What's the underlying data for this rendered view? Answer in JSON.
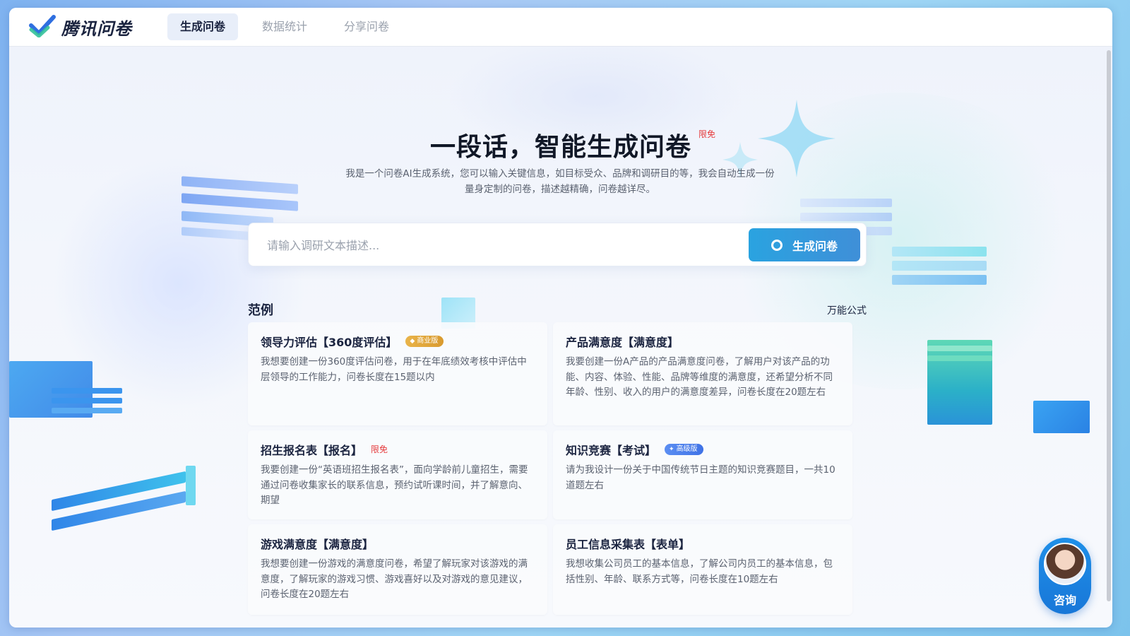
{
  "header": {
    "logo_text": "腾讯问卷",
    "tabs": [
      {
        "label": "生成问卷",
        "active": true
      },
      {
        "label": "数据统计",
        "active": false
      },
      {
        "label": "分享问卷",
        "active": false
      }
    ]
  },
  "hero": {
    "title": "一段话，智能生成问卷",
    "badge": "限免",
    "desc_line1": "我是一个问卷AI生成系统，您可以输入关键信息，如目标受众、品牌和调研目的等，我会自动生成一份",
    "desc_line2": "量身定制的问卷，描述越精确，问卷越详尽。"
  },
  "search": {
    "placeholder": "请输入调研文本描述...",
    "value": "",
    "button_label": "生成问卷"
  },
  "examples": {
    "label": "范例",
    "formula_link": "万能公式",
    "cards": [
      {
        "title": "领导力评估【360度评估】",
        "tag": "商业版",
        "tag_style": "gold",
        "desc": "我想要创建一份360度评估问卷，用于在年底绩效考核中评估中层领导的工作能力，问卷长度在15题以内"
      },
      {
        "title": "产品满意度【满意度】",
        "tag": "",
        "tag_style": "",
        "desc": "我要创建一份A产品的产品满意度问卷，了解用户对该产品的功能、内容、体验、性能、品牌等维度的满意度，还希望分析不同年龄、性别、收入的用户的满意度差异，问卷长度在20题左右"
      },
      {
        "title": "招生报名表【报名】",
        "tag": "限免",
        "tag_style": "free",
        "desc": "我要创建一份“英语班招生报名表”，面向学龄前儿童招生，需要通过问卷收集家长的联系信息，预约试听课时间，并了解意向、期望"
      },
      {
        "title": "知识竞赛【考试】",
        "tag": "高级版",
        "tag_style": "blue",
        "desc": "请为我设计一份关于中国传统节日主题的知识竞赛题目，一共10道题左右"
      },
      {
        "title": "游戏满意度【满意度】",
        "tag": "",
        "tag_style": "",
        "desc": "我想要创建一份游戏的满意度问卷，希望了解玩家对该游戏的满意度，了解玩家的游戏习惯、游戏喜好以及对游戏的意见建议，问卷长度在20题左右"
      },
      {
        "title": "员工信息采集表【表单】",
        "tag": "",
        "tag_style": "",
        "desc": "我想收集公司员工的基本信息，了解公司内员工的基本信息，包括性别、年龄、联系方式等，问卷长度在10题左右"
      }
    ]
  },
  "consult": {
    "label": "咨询"
  },
  "colors": {
    "accent": "#2aa3e0",
    "text_primary": "#1b2440",
    "text_secondary": "#5b6270",
    "badge_red": "#e5393b"
  },
  "icons": {
    "logo": "check-mark-icon",
    "generate": "ring-icon",
    "tag_gold": "diamond-icon",
    "tag_blue": "plus-icon"
  }
}
